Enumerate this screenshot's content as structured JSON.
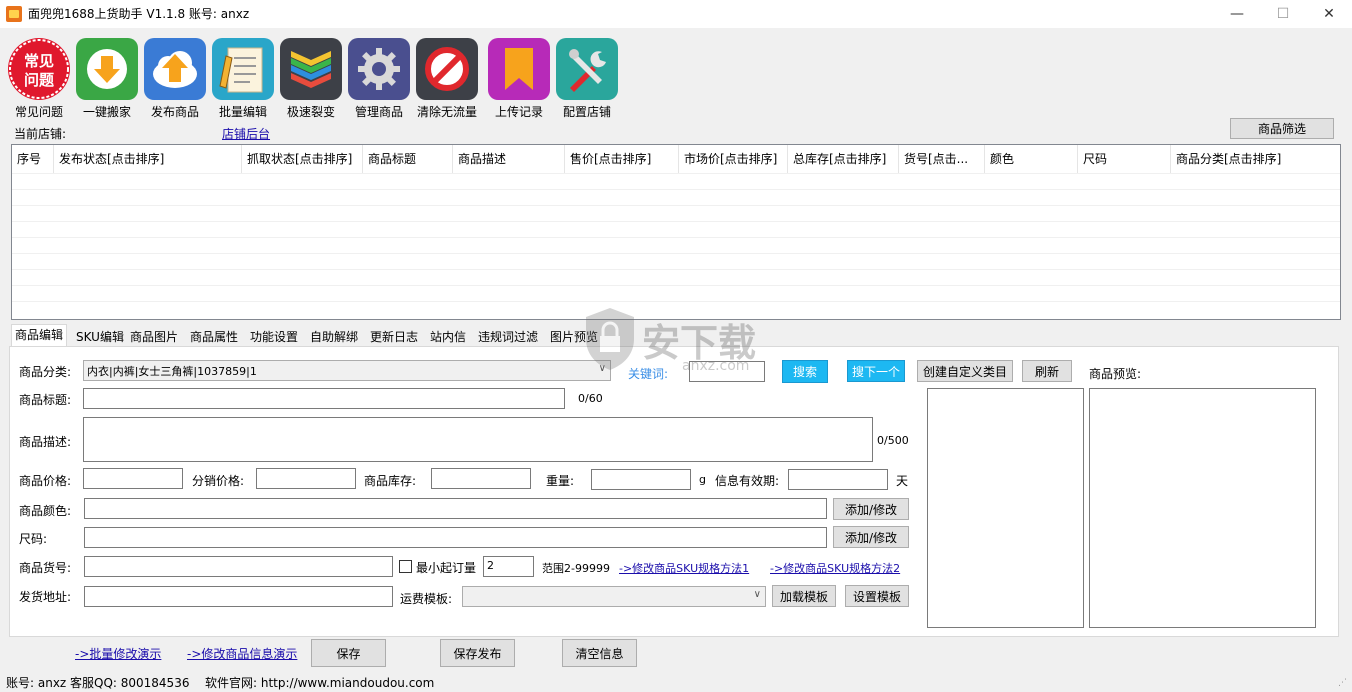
{
  "window": {
    "title": "面兜兜1688上货助手 V1.1.8   账号: anxz",
    "controls": [
      "—",
      "☐",
      "✕"
    ]
  },
  "toolbar": [
    {
      "label": "常见问题",
      "icon": "faq-icon",
      "icon_text": "常见\n问题",
      "color": "#e0182d"
    },
    {
      "label": "一键搬家",
      "icon": "download-icon",
      "color": "#3aa745"
    },
    {
      "label": "发布商品",
      "icon": "upload-icon",
      "color": "#3a7bd5"
    },
    {
      "label": "批量编辑",
      "icon": "edit-document-icon",
      "color": "#2aa6c9"
    },
    {
      "label": "极速裂变",
      "icon": "layers-icon",
      "color": "#3d4047"
    },
    {
      "label": "管理商品",
      "icon": "gear-icon",
      "color": "#4a4f8f"
    },
    {
      "label": "清除无流量",
      "icon": "forbidden-icon",
      "color": "#3d4047"
    },
    {
      "label": "上传记录",
      "icon": "bookmark-icon",
      "color": "#b72ab8"
    },
    {
      "label": "配置店铺",
      "icon": "tools-icon",
      "color": "#2aa69c"
    }
  ],
  "store": {
    "current_label": "当前店铺:",
    "backend_link": "店铺后台",
    "filter_button": "商品筛选"
  },
  "grid": {
    "columns": [
      "序号",
      "发布状态[点击排序]",
      "抓取状态[点击排序]",
      "商品标题",
      "商品描述",
      "售价[点击排序]",
      "市场价[点击排序]",
      "总库存[点击排序]",
      "货号[点击...",
      "颜色",
      "尺码",
      "商品分类[点击排序]"
    ],
    "rows": []
  },
  "tabs": [
    "商品编辑",
    "SKU编辑",
    "商品图片",
    "商品属性",
    "功能设置",
    "自助解绑",
    "更新日志",
    "站内信",
    "违规词过滤",
    "图片预览"
  ],
  "form": {
    "category_label": "商品分类:",
    "category_value": "内衣|内裤|女士三角裤|1037859|1",
    "keyword_label": "关键词:",
    "keyword_value": "",
    "search_button": "搜索",
    "search_next_button": "搜下一个",
    "create_category_button": "创建自定义类目",
    "refresh_button": "刷新",
    "preview_label": "商品预览:",
    "title_label": "商品标题:",
    "title_value": "",
    "title_count": "0/60",
    "desc_label": "商品描述:",
    "desc_value": "",
    "desc_count": "0/500",
    "price_label": "商品价格:",
    "price_value": "",
    "dist_price_label": "分销价格:",
    "dist_price_value": "",
    "stock_label": "商品库存:",
    "stock_value": "",
    "weight_label": "重量:",
    "weight_value": "",
    "weight_unit": "g",
    "valid_label": "信息有效期:",
    "valid_value": "",
    "valid_unit": "天",
    "color_label": "商品颜色:",
    "color_value": "",
    "add_edit_button": "添加/修改",
    "size_label": "尺码:",
    "size_value": "",
    "sku_label": "商品货号:",
    "sku_value": "",
    "min_order_label": "最小起订量",
    "min_order_checked": false,
    "min_order_value": "2",
    "range_label": "范围2-99999",
    "sku_method1_link": "->修改商品SKU规格方法1",
    "sku_method2_link": "->修改商品SKU规格方法2",
    "address_label": "发货地址:",
    "address_value": "",
    "freight_label": "运费模板:",
    "freight_value": "",
    "load_template_button": "加载模板",
    "set_template_button": "设置模板"
  },
  "bottom": {
    "batch_demo_link": "->批量修改演示",
    "edit_demo_link": "->修改商品信息演示",
    "save_button": "保存",
    "save_publish_button": "保存发布",
    "clear_button": "清空信息"
  },
  "status": {
    "account": "账号: anxz",
    "qq": "客服QQ:  800184536",
    "website": "软件官网:  http://www.miandoudou.com"
  },
  "watermark": {
    "text": "安下载",
    "sub": "anxz.com"
  }
}
